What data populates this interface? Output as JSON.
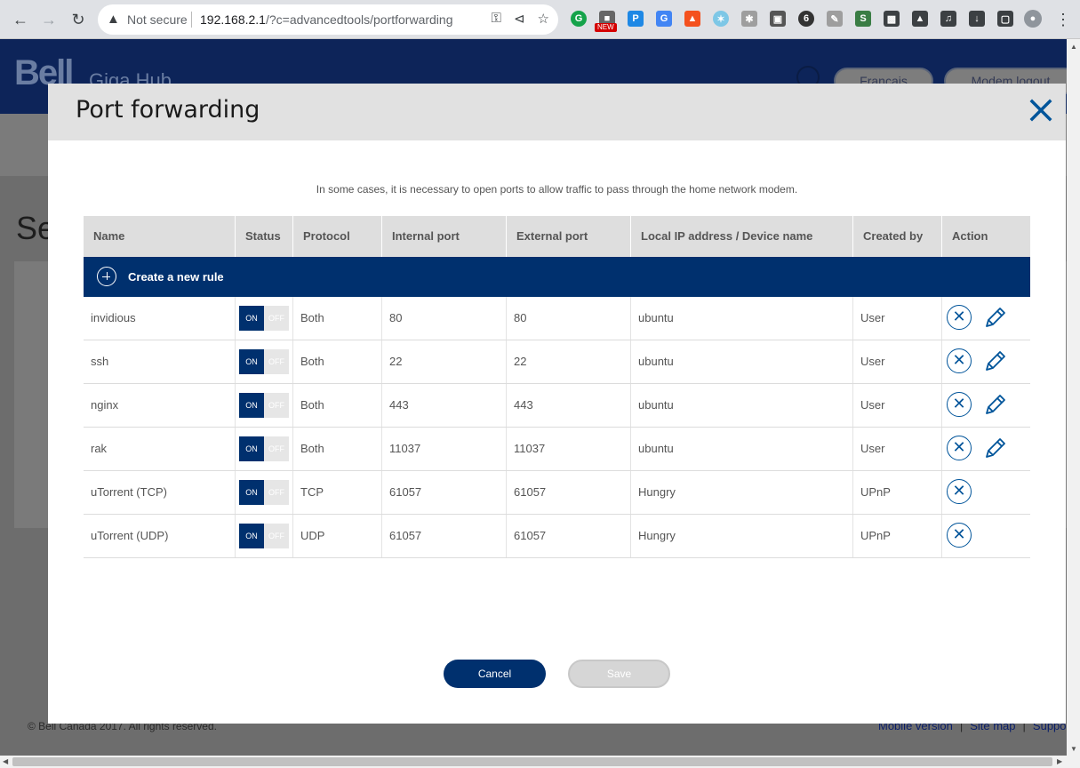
{
  "browser": {
    "security_text": "Not secure",
    "url_host": "192.168.2.1",
    "url_path": "/?c=advancedtools/portforwarding",
    "new_badge": "NEW"
  },
  "background": {
    "logo": "Bell",
    "product": "Giga Hub",
    "lang_button": "Français",
    "logout_button": "Modem logout",
    "partial_heading": "Se",
    "copyright": "© Bell Canada 2017. All rights reserved.",
    "footer_links": [
      "Mobile version",
      "Site map",
      "Suppo"
    ]
  },
  "modal": {
    "title": "Port forwarding",
    "intro": "In some cases, it is necessary to open ports to allow traffic to pass through the home network modem.",
    "create_rule": "Create a new rule",
    "columns": [
      "Name",
      "Status",
      "Protocol",
      "Internal port",
      "External port",
      "Local IP address / Device name",
      "Created by",
      "Action"
    ],
    "toggle_on": "ON",
    "toggle_off": "OFF",
    "rows": [
      {
        "name": "invidious",
        "protocol": "Both",
        "internal": "80",
        "external": "80",
        "device": "ubuntu",
        "created_by": "User",
        "status": "on",
        "editable": true
      },
      {
        "name": "ssh",
        "protocol": "Both",
        "internal": "22",
        "external": "22",
        "device": "ubuntu",
        "created_by": "User",
        "status": "on",
        "editable": true
      },
      {
        "name": "nginx",
        "protocol": "Both",
        "internal": "443",
        "external": "443",
        "device": "ubuntu",
        "created_by": "User",
        "status": "on",
        "editable": true
      },
      {
        "name": "rak",
        "protocol": "Both",
        "internal": "11037",
        "external": "11037",
        "device": "ubuntu",
        "created_by": "User",
        "status": "on",
        "editable": true
      },
      {
        "name": "uTorrent (TCP)",
        "protocol": "TCP",
        "internal": "61057",
        "external": "61057",
        "device": "Hungry",
        "created_by": "UPnP",
        "status": "on",
        "editable": false
      },
      {
        "name": "uTorrent (UDP)",
        "protocol": "UDP",
        "internal": "61057",
        "external": "61057",
        "device": "Hungry",
        "created_by": "UPnP",
        "status": "on",
        "editable": false
      }
    ],
    "cancel": "Cancel",
    "save": "Save"
  },
  "colors": {
    "brand_blue": "#00306e",
    "icon_blue": "#00549a",
    "header_gray": "#e1e1e1"
  }
}
